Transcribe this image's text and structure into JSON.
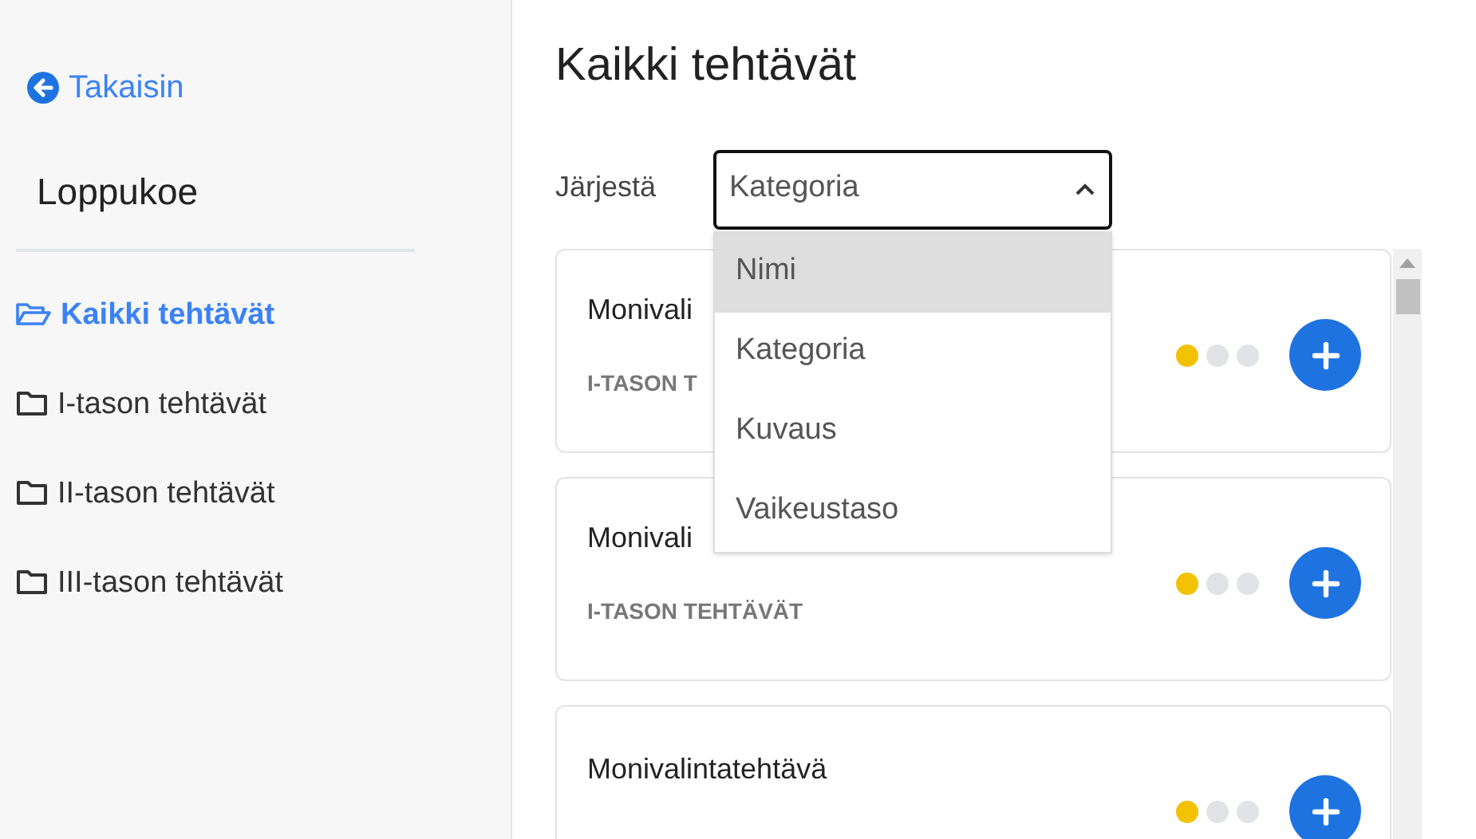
{
  "sidebar": {
    "back_link": "Takaisin",
    "title": "Loppukoe",
    "items": [
      {
        "label": "Kaikki tehtävät",
        "selected": true
      },
      {
        "label": "I-tason tehtävät",
        "selected": false
      },
      {
        "label": "II-tason tehtävät",
        "selected": false
      },
      {
        "label": "III-tason tehtävät",
        "selected": false
      }
    ]
  },
  "main": {
    "title": "Kaikki tehtävät",
    "sort": {
      "label": "Järjestä",
      "value": "Kategoria",
      "expanded": true,
      "options": [
        {
          "label": "Nimi",
          "highlighted": true
        },
        {
          "label": "Kategoria",
          "highlighted": false
        },
        {
          "label": "Kuvaus",
          "highlighted": false
        },
        {
          "label": "Vaikeustaso",
          "highlighted": false
        }
      ]
    },
    "cards": [
      {
        "title": "Monivali",
        "category": "I-TASON T",
        "stars": 1
      },
      {
        "title": "Monivali",
        "category": "I-TASON TEHTÄVÄT",
        "stars": 1
      },
      {
        "title": "Monivalintatehtävä",
        "stars": 1
      }
    ]
  }
}
